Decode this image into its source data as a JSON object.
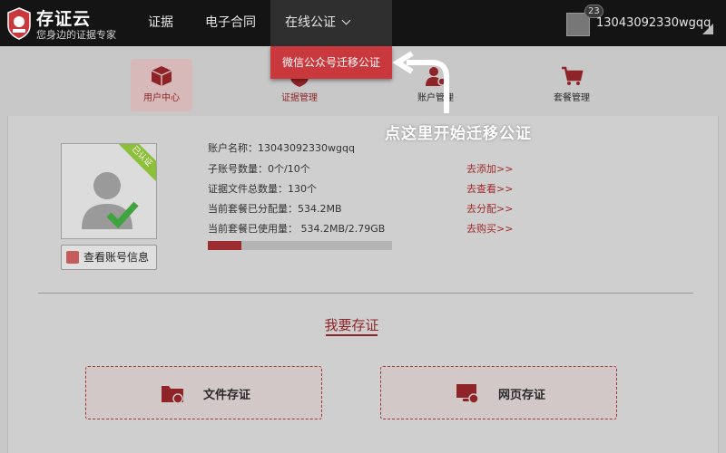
{
  "brand": {
    "name": "存证云",
    "tagline": "您身边的证据专家"
  },
  "nav": {
    "items": [
      "证据",
      "电子合同"
    ],
    "active": "在线公证"
  },
  "user": {
    "notification_count": "23",
    "username": "13043092330wgqq"
  },
  "dropdown": {
    "item": "微信公众号迁移公证"
  },
  "tabs": [
    {
      "label": "用户中心",
      "icon": "cube-icon"
    },
    {
      "label": "证据管理",
      "icon": "shield-icon"
    },
    {
      "label": "账户管理",
      "icon": "user-gear-icon"
    },
    {
      "label": "套餐管理",
      "icon": "cart-icon"
    }
  ],
  "annotation": "点这里开始迁移公证",
  "profile": {
    "verified_ribbon": "已认证",
    "view_button": "查看账号信息",
    "lines": [
      "账户名称：13043092330wgqq",
      "子账号数量：0个/10个",
      "证据文件总数量：130个",
      "当前套餐已分配量：534.2MB",
      "当前套餐已使用量：  534.2MB/2.79GB"
    ],
    "links": [
      "去添加>>",
      "去查看>>",
      "去分配>>",
      "去购买>>"
    ],
    "usage_fraction": 0.18
  },
  "section": {
    "title": "我要存证",
    "cards": [
      {
        "label": "文件存证",
        "icon": "folder-icon"
      },
      {
        "label": "网页存证",
        "icon": "monitor-icon"
      }
    ]
  },
  "colors": {
    "accent": "#8e2427",
    "dropdown": "#c9383c",
    "verified": "#8cbf3a"
  }
}
